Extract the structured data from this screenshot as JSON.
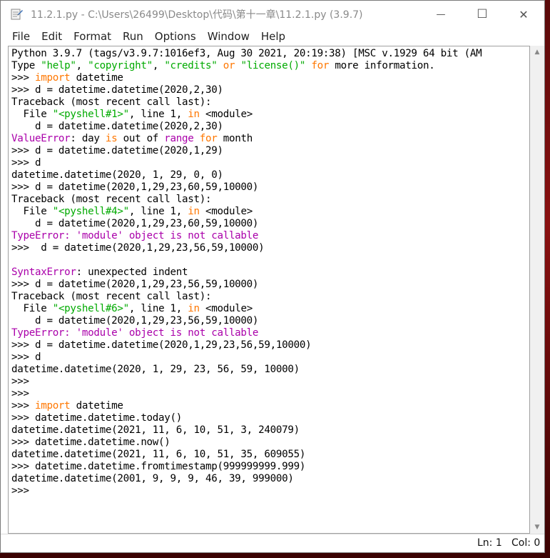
{
  "window": {
    "title": "11.2.1.py - C:\\Users\\26499\\Desktop\\代码\\第十一章\\11.2.1.py (3.9.7)",
    "minimize": "—",
    "maximize": "☐",
    "close": "✕"
  },
  "menu": [
    "File",
    "Edit",
    "Format",
    "Run",
    "Options",
    "Window",
    "Help"
  ],
  "shell": {
    "lines": [
      [
        {
          "c": "out",
          "t": "Python 3.9.7 (tags/v3.9.7:1016ef3, Aug 30 2021, 20:19:38) [MSC v.1929 64 bit (AM"
        }
      ],
      [
        {
          "c": "out",
          "t": "Type "
        },
        {
          "c": "str",
          "t": "\"help\""
        },
        {
          "c": "out",
          "t": ", "
        },
        {
          "c": "str",
          "t": "\"copyright\""
        },
        {
          "c": "out",
          "t": ", "
        },
        {
          "c": "str",
          "t": "\"credits\""
        },
        {
          "c": "out",
          "t": " "
        },
        {
          "c": "kw",
          "t": "or"
        },
        {
          "c": "out",
          "t": " "
        },
        {
          "c": "str",
          "t": "\"license()\""
        },
        {
          "c": "out",
          "t": " "
        },
        {
          "c": "kw",
          "t": "for"
        },
        {
          "c": "out",
          "t": " more information."
        }
      ],
      [
        {
          "c": "prompt",
          "t": ">>> "
        },
        {
          "c": "kw",
          "t": "import"
        },
        {
          "c": "out",
          "t": " datetime"
        }
      ],
      [
        {
          "c": "prompt",
          "t": ">>> "
        },
        {
          "c": "out",
          "t": "d = datetime.datetime(2020,2,30)"
        }
      ],
      [
        {
          "c": "out",
          "t": "Traceback (most recent call last):"
        }
      ],
      [
        {
          "c": "out",
          "t": "  File "
        },
        {
          "c": "str",
          "t": "\"<pyshell#1>\""
        },
        {
          "c": "out",
          "t": ", line 1, "
        },
        {
          "c": "kw",
          "t": "in"
        },
        {
          "c": "out",
          "t": " <module>"
        }
      ],
      [
        {
          "c": "out",
          "t": "    d = datetime.datetime(2020,2,30)"
        }
      ],
      [
        {
          "c": "err",
          "t": "ValueError"
        },
        {
          "c": "out",
          "t": ": day "
        },
        {
          "c": "kw",
          "t": "is"
        },
        {
          "c": "out",
          "t": " out of "
        },
        {
          "c": "err",
          "t": "range"
        },
        {
          "c": "out",
          "t": " "
        },
        {
          "c": "kw",
          "t": "for"
        },
        {
          "c": "out",
          "t": " month"
        }
      ],
      [
        {
          "c": "prompt",
          "t": ">>> "
        },
        {
          "c": "out",
          "t": "d = datetime.datetime(2020,1,29)"
        }
      ],
      [
        {
          "c": "prompt",
          "t": ">>> "
        },
        {
          "c": "out",
          "t": "d"
        }
      ],
      [
        {
          "c": "out",
          "t": "datetime.datetime(2020, 1, 29, 0, 0)"
        }
      ],
      [
        {
          "c": "prompt",
          "t": ">>> "
        },
        {
          "c": "out",
          "t": "d = datetime(2020,1,29,23,60,59,10000)"
        }
      ],
      [
        {
          "c": "out",
          "t": "Traceback (most recent call last):"
        }
      ],
      [
        {
          "c": "out",
          "t": "  File "
        },
        {
          "c": "str",
          "t": "\"<pyshell#4>\""
        },
        {
          "c": "out",
          "t": ", line 1, "
        },
        {
          "c": "kw",
          "t": "in"
        },
        {
          "c": "out",
          "t": " <module>"
        }
      ],
      [
        {
          "c": "out",
          "t": "    d = datetime(2020,1,29,23,60,59,10000)"
        }
      ],
      [
        {
          "c": "err",
          "t": "TypeError: 'module' object is not callable"
        }
      ],
      [
        {
          "c": "prompt",
          "t": ">>> "
        },
        {
          "c": "out",
          "t": " d = datetime(2020,1,29,23,56,59,10000)"
        }
      ],
      [
        {
          "c": "out",
          "t": ""
        }
      ],
      [
        {
          "c": "err",
          "t": "SyntaxError"
        },
        {
          "c": "out",
          "t": ": unexpected indent"
        }
      ],
      [
        {
          "c": "prompt",
          "t": ">>> "
        },
        {
          "c": "out",
          "t": "d = datetime(2020,1,29,23,56,59,10000)"
        }
      ],
      [
        {
          "c": "out",
          "t": "Traceback (most recent call last):"
        }
      ],
      [
        {
          "c": "out",
          "t": "  File "
        },
        {
          "c": "str",
          "t": "\"<pyshell#6>\""
        },
        {
          "c": "out",
          "t": ", line 1, "
        },
        {
          "c": "kw",
          "t": "in"
        },
        {
          "c": "out",
          "t": " <module>"
        }
      ],
      [
        {
          "c": "out",
          "t": "    d = datetime(2020,1,29,23,56,59,10000)"
        }
      ],
      [
        {
          "c": "err",
          "t": "TypeError: 'module' object is not callable"
        }
      ],
      [
        {
          "c": "prompt",
          "t": ">>> "
        },
        {
          "c": "out",
          "t": "d = datetime.datetime(2020,1,29,23,56,59,10000)"
        }
      ],
      [
        {
          "c": "prompt",
          "t": ">>> "
        },
        {
          "c": "out",
          "t": "d"
        }
      ],
      [
        {
          "c": "out",
          "t": "datetime.datetime(2020, 1, 29, 23, 56, 59, 10000)"
        }
      ],
      [
        {
          "c": "prompt",
          "t": ">>>"
        }
      ],
      [
        {
          "c": "prompt",
          "t": ">>>"
        }
      ],
      [
        {
          "c": "prompt",
          "t": ">>> "
        },
        {
          "c": "kw",
          "t": "import"
        },
        {
          "c": "out",
          "t": " datetime"
        }
      ],
      [
        {
          "c": "prompt",
          "t": ">>> "
        },
        {
          "c": "out",
          "t": "datetime.datetime.today()"
        }
      ],
      [
        {
          "c": "out",
          "t": "datetime.datetime(2021, 11, 6, 10, 51, 3, 240079)"
        }
      ],
      [
        {
          "c": "prompt",
          "t": ">>> "
        },
        {
          "c": "out",
          "t": "datetime.datetime.now()"
        }
      ],
      [
        {
          "c": "out",
          "t": "datetime.datetime(2021, 11, 6, 10, 51, 35, 609055)"
        }
      ],
      [
        {
          "c": "prompt",
          "t": ">>> "
        },
        {
          "c": "out",
          "t": "datetime.datetime.fromtimestamp(999999999.999)"
        }
      ],
      [
        {
          "c": "out",
          "t": "datetime.datetime(2001, 9, 9, 9, 46, 39, 999000)"
        }
      ],
      [
        {
          "c": "prompt",
          "t": ">>>"
        }
      ]
    ]
  },
  "status": {
    "line": "Ln: 1",
    "col": "Col: 0"
  },
  "colors": {
    "keyword": "#ff7700",
    "string": "#00aa00",
    "error": "#aa00aa"
  }
}
